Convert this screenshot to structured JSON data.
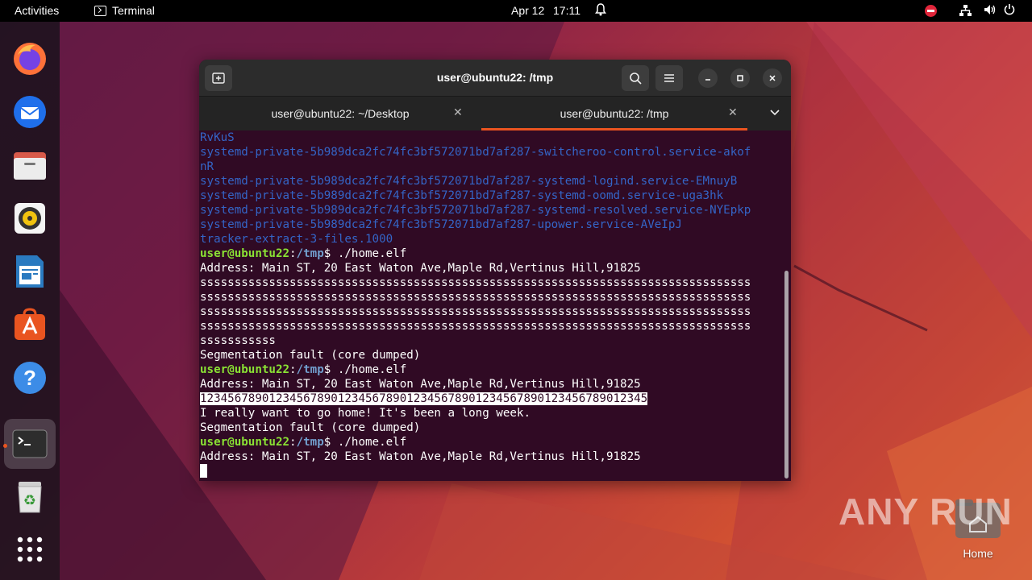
{
  "topbar": {
    "activities": "Activities",
    "app_name": "Terminal",
    "date": "Apr 12",
    "time": "17:11"
  },
  "dock": {
    "items": [
      "firefox-icon",
      "thunderbird-icon",
      "files-icon",
      "rhythmbox-icon",
      "libreoffice-writer-icon",
      "app-center-icon",
      "help-icon",
      "terminal-icon",
      "trash-icon",
      "show-apps-icon"
    ]
  },
  "window": {
    "title": "user@ubuntu22: /tmp",
    "tabs": [
      {
        "label": "user@ubuntu22: ~/Desktop",
        "active": false
      },
      {
        "label": "user@ubuntu22: /tmp",
        "active": true
      }
    ]
  },
  "terminal": {
    "lines": [
      {
        "type": "blue",
        "text": "RvKuS"
      },
      {
        "type": "blue",
        "text": "systemd-private-5b989dca2fc74fc3bf572071bd7af287-switcheroo-control.service-akof"
      },
      {
        "type": "blue",
        "text": "nR"
      },
      {
        "type": "blue",
        "text": "systemd-private-5b989dca2fc74fc3bf572071bd7af287-systemd-logind.service-EMnuyB"
      },
      {
        "type": "blue",
        "text": "systemd-private-5b989dca2fc74fc3bf572071bd7af287-systemd-oomd.service-uga3hk"
      },
      {
        "type": "blue",
        "text": "systemd-private-5b989dca2fc74fc3bf572071bd7af287-systemd-resolved.service-NYEpkp"
      },
      {
        "type": "blue",
        "text": "systemd-private-5b989dca2fc74fc3bf572071bd7af287-upower.service-AVeIpJ"
      },
      {
        "type": "blue",
        "text": "tracker-extract-3-files.1000"
      },
      {
        "type": "prompt",
        "user": "user@ubuntu22",
        "path": "/tmp",
        "cmd": "$ ./home.elf"
      },
      {
        "type": "plain",
        "text": "Address: Main ST, 20 East Waton Ave,Maple Rd,Vertinus Hill,91825"
      },
      {
        "type": "plain",
        "text": "ssssssssssssssssssssssssssssssssssssssssssssssssssssssssssssssssssssssssssssssss"
      },
      {
        "type": "plain",
        "text": "ssssssssssssssssssssssssssssssssssssssssssssssssssssssssssssssssssssssssssssssss"
      },
      {
        "type": "plain",
        "text": "ssssssssssssssssssssssssssssssssssssssssssssssssssssssssssssssssssssssssssssssss"
      },
      {
        "type": "plain",
        "text": "ssssssssssssssssssssssssssssssssssssssssssssssssssssssssssssssssssssssssssssssss"
      },
      {
        "type": "plain",
        "text": "sssssssssss"
      },
      {
        "type": "plain",
        "text": "Segmentation fault (core dumped)"
      },
      {
        "type": "prompt",
        "user": "user@ubuntu22",
        "path": "/tmp",
        "cmd": "$ ./home.elf"
      },
      {
        "type": "plain",
        "text": "Address: Main ST, 20 East Waton Ave,Maple Rd,Vertinus Hill,91825"
      },
      {
        "type": "selected",
        "text": "12345678901234567890123456789012345678901234567890123456789012345"
      },
      {
        "type": "plain",
        "text": "I really want to go home! It's been a long week."
      },
      {
        "type": "plain",
        "text": "Segmentation fault (core dumped)"
      },
      {
        "type": "prompt",
        "user": "user@ubuntu22",
        "path": "/tmp",
        "cmd": "$ ./home.elf"
      },
      {
        "type": "plain",
        "text": "Address: Main ST, 20 East Waton Ave,Maple Rd,Vertinus Hill,91825"
      },
      {
        "type": "cursor",
        "text": ""
      }
    ]
  },
  "desktop": {
    "home_label": "Home",
    "watermark": "ANY RUN"
  },
  "colors": {
    "terminal_bg": "#300a24",
    "prompt_user": "#8ae234",
    "prompt_path": "#729fcf",
    "dir_blue": "#3465c7",
    "accent": "#e95420"
  }
}
